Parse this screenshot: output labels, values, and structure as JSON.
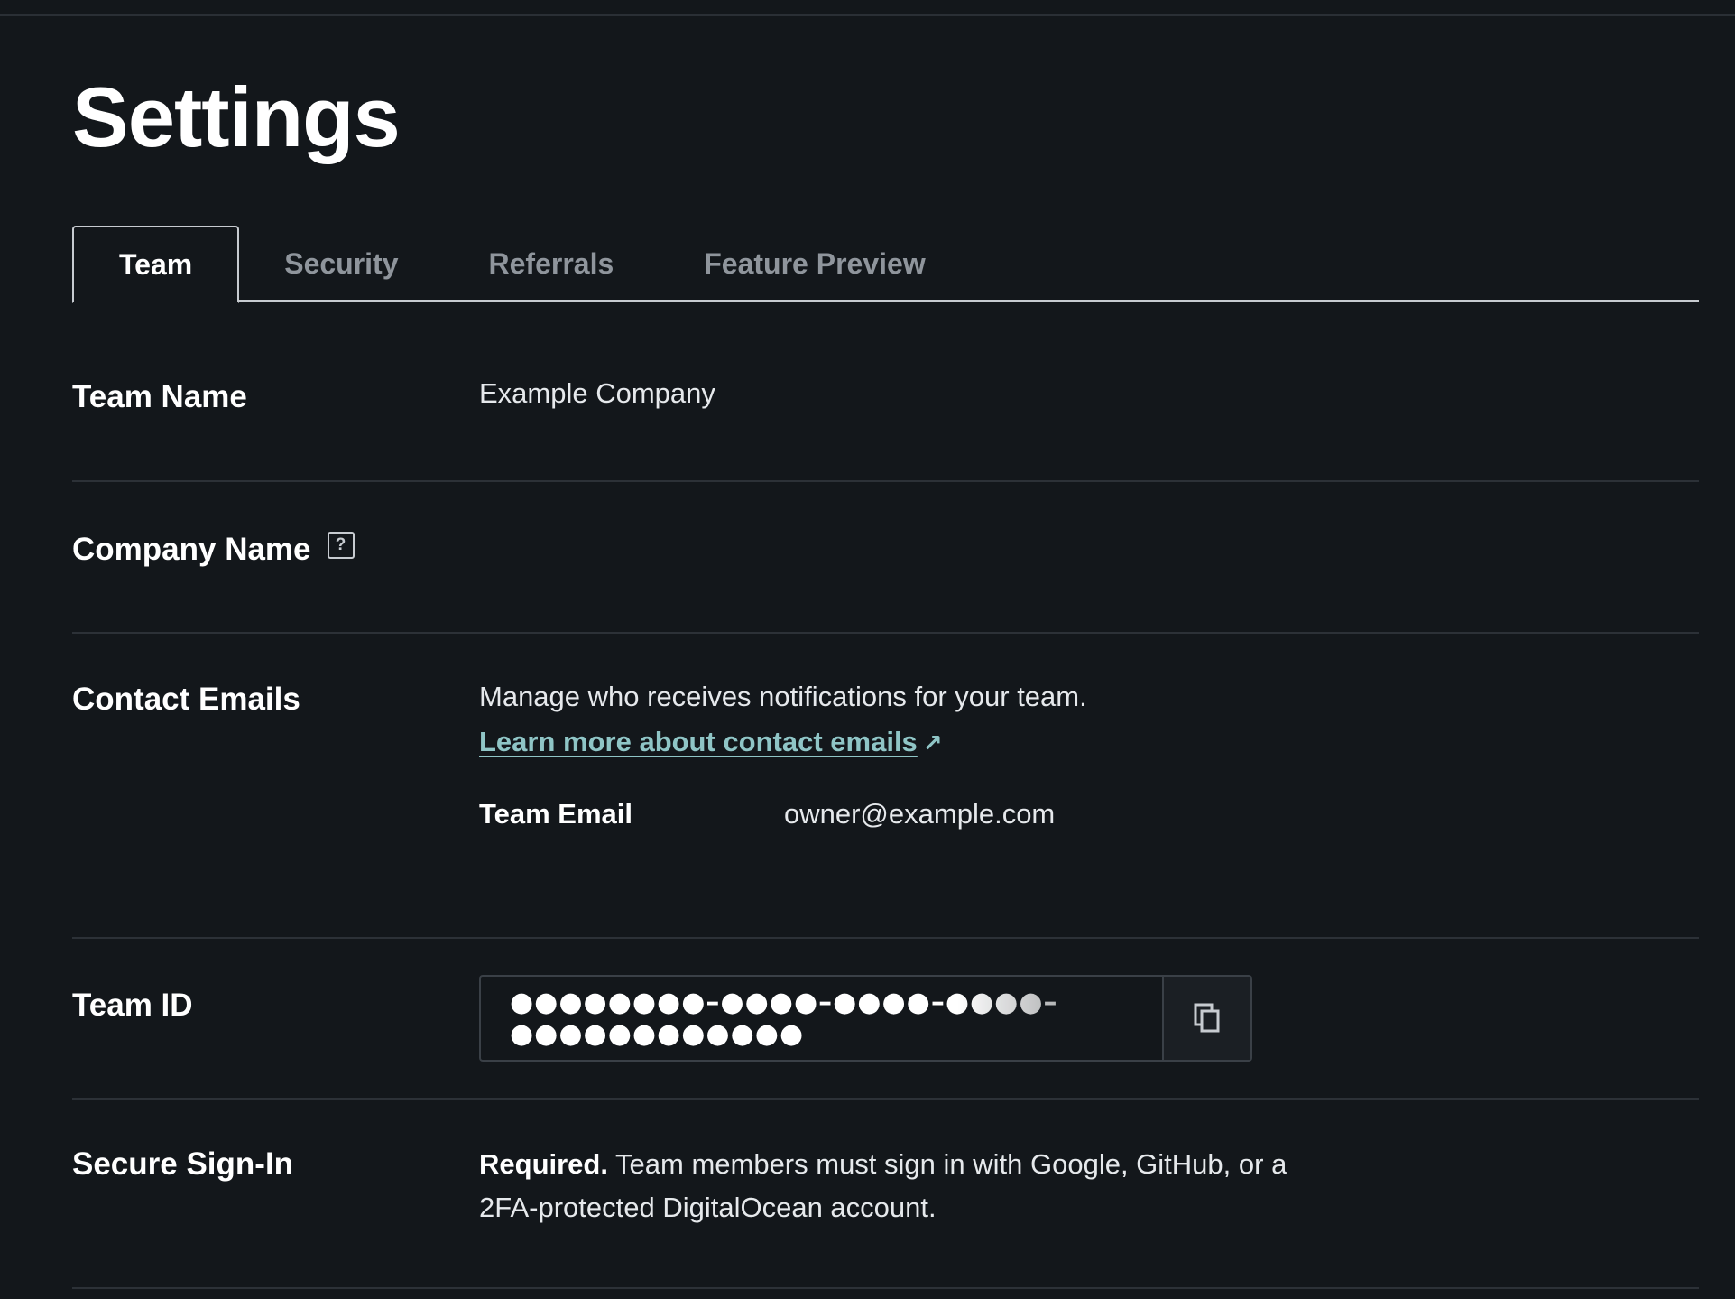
{
  "page": {
    "title": "Settings"
  },
  "tabs": [
    {
      "label": "Team",
      "active": true
    },
    {
      "label": "Security",
      "active": false
    },
    {
      "label": "Referrals",
      "active": false
    },
    {
      "label": "Feature Preview",
      "active": false
    }
  ],
  "team_name": {
    "label": "Team Name",
    "value": "Example Company"
  },
  "company_name": {
    "label": "Company Name",
    "help_icon": "question-icon",
    "help_glyph": "?"
  },
  "contact_emails": {
    "label": "Contact Emails",
    "description": "Manage who receives notifications for your team.",
    "link_text": "Learn more about contact emails",
    "link_icon": "external-arrow-icon",
    "link_glyph": "↗",
    "team_email_label": "Team Email",
    "team_email_value": "owner@example.com"
  },
  "team_id": {
    "label": "Team ID",
    "masked_value": "●●●●●●●●–●●●●–●●●●–●●●●–●●●●●●●●●●●●",
    "copy_icon": "copy-icon"
  },
  "secure_sign_in": {
    "label": "Secure Sign-In",
    "status": "Required.",
    "text": " Team members must sign in with Google, GitHub, or a 2FA-protected DigitalOcean account."
  },
  "colors": {
    "background": "#13171b",
    "link": "#8fc5c6",
    "divider": "#2c3137",
    "muted_tab": "#8f959c"
  }
}
